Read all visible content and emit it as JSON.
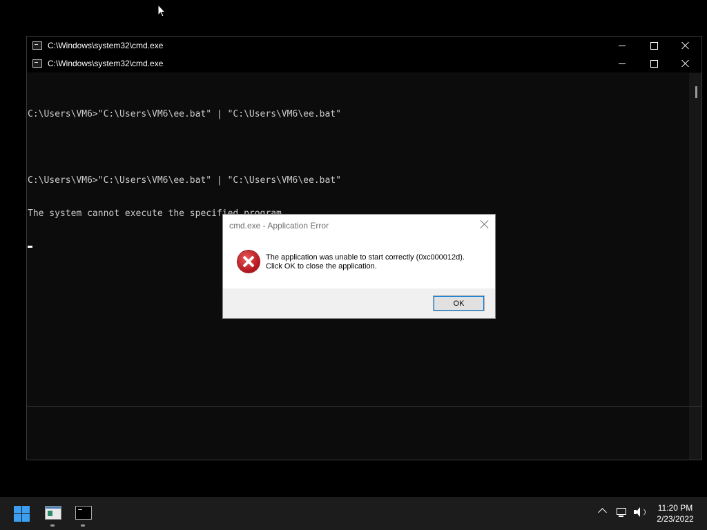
{
  "back_window": {
    "title": "C:\\Windows\\system32\\cmd.exe"
  },
  "front_window": {
    "title": "C:\\Windows\\system32\\cmd.exe",
    "console_lines": [
      "C:\\Users\\VM6>\"C:\\Users\\VM6\\ee.bat\" | \"C:\\Users\\VM6\\ee.bat\"",
      "",
      "C:\\Users\\VM6>\"C:\\Users\\VM6\\ee.bat\" | \"C:\\Users\\VM6\\ee.bat\"",
      "The system cannot execute the specified program."
    ]
  },
  "dialog": {
    "title": "cmd.exe - Application Error",
    "message_line1": "The application was unable to start correctly (0xc000012d).",
    "message_line2": "Click OK to close the application.",
    "ok_label": "OK"
  },
  "taskbar": {
    "time": "11:20 PM",
    "date": "2/23/2022",
    "icons": [
      "windows-start-icon",
      "notepad-icon",
      "cmd-icon",
      "chevron-up-icon",
      "network-icon",
      "volume-icon"
    ]
  },
  "colors": {
    "console_bg": "#0c0c0c",
    "console_text": "#cccccc",
    "taskbar_bg": "#1c1c1c",
    "start_blue": "#3d9ff2",
    "error_red": "#b3141b"
  }
}
